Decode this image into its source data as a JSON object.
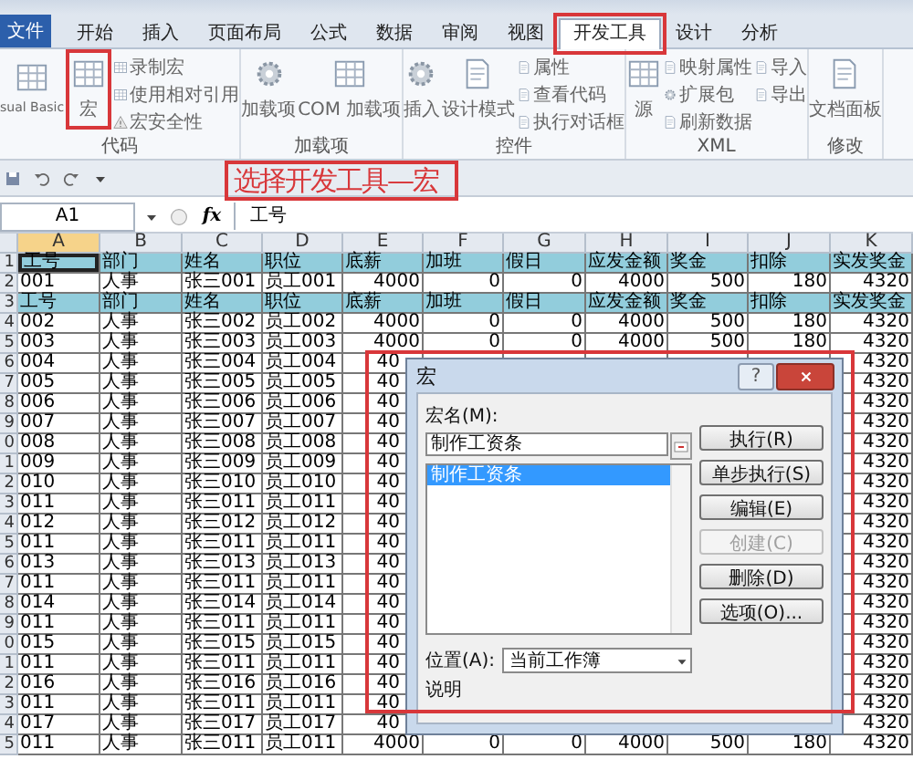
{
  "tabs": [
    {
      "label": "文件",
      "kind": "file",
      "selected": false
    },
    {
      "label": "开始",
      "kind": "tab",
      "selected": false
    },
    {
      "label": "插入",
      "kind": "tab",
      "selected": false
    },
    {
      "label": "页面布局",
      "kind": "tab",
      "selected": false
    },
    {
      "label": "公式",
      "kind": "tab",
      "selected": false
    },
    {
      "label": "数据",
      "kind": "tab",
      "selected": false
    },
    {
      "label": "审阅",
      "kind": "tab",
      "selected": false
    },
    {
      "label": "视图",
      "kind": "tab",
      "selected": false
    },
    {
      "label": "开发工具",
      "kind": "tab",
      "selected": true
    },
    {
      "label": "设计",
      "kind": "tab",
      "selected": false
    },
    {
      "label": "分析",
      "kind": "tab",
      "selected": false
    }
  ],
  "ribbon": {
    "groups": [
      {
        "label": "代码",
        "items": [
          {
            "label": "sual Basic",
            "kind": "large"
          },
          {
            "label": "宏",
            "kind": "large"
          },
          {
            "label": "录制宏",
            "kind": "small"
          },
          {
            "label": "使用相对引用",
            "kind": "small"
          },
          {
            "label": "宏安全性",
            "kind": "small"
          }
        ]
      },
      {
        "label": "加载项",
        "items": [
          {
            "label": "加载项",
            "kind": "large"
          },
          {
            "label": "COM 加载项",
            "kind": "large"
          }
        ]
      },
      {
        "label": "控件",
        "items": [
          {
            "label": "插入",
            "kind": "large"
          },
          {
            "label": "设计模式",
            "kind": "large"
          },
          {
            "label": "属性",
            "kind": "small"
          },
          {
            "label": "查看代码",
            "kind": "small"
          },
          {
            "label": "执行对话框",
            "kind": "small"
          }
        ]
      },
      {
        "label": "XML",
        "items": [
          {
            "label": "源",
            "kind": "large"
          },
          {
            "label": "映射属性",
            "kind": "small"
          },
          {
            "label": "扩展包",
            "kind": "small"
          },
          {
            "label": "刷新数据",
            "kind": "small"
          },
          {
            "label": "导入",
            "kind": "small"
          },
          {
            "label": "导出",
            "kind": "small"
          }
        ]
      },
      {
        "label": "修改",
        "items": [
          {
            "label": "文档面板",
            "kind": "large"
          }
        ]
      }
    ]
  },
  "annotation": {
    "text": "选择开发工具—宏"
  },
  "formula_bar": {
    "name_box": "A1",
    "function_label": "fx",
    "formula": "工号"
  },
  "sheet": {
    "columns": [
      {
        "label": "A",
        "selected": true
      },
      {
        "label": "B",
        "selected": false
      },
      {
        "label": "C",
        "selected": false
      },
      {
        "label": "D",
        "selected": false
      },
      {
        "label": "E",
        "selected": false
      },
      {
        "label": "F",
        "selected": false
      },
      {
        "label": "G",
        "selected": false
      },
      {
        "label": "H",
        "selected": false
      },
      {
        "label": "I",
        "selected": false
      },
      {
        "label": "J",
        "selected": false
      },
      {
        "label": "K",
        "selected": false
      }
    ],
    "rows": [
      {
        "number": "1",
        "kind": "header",
        "cells": [
          "工号",
          "部门",
          "姓名",
          "职位",
          "底薪",
          "加班",
          "假日",
          "应发金额",
          "奖金",
          "扣除",
          "实发奖金"
        ]
      },
      {
        "number": "2",
        "kind": "data",
        "cells": [
          "001",
          "人事",
          "张三001",
          "员工001",
          "4000",
          "0",
          "0",
          "4000",
          "500",
          "180",
          "4320"
        ]
      },
      {
        "number": "3",
        "kind": "header",
        "cells": [
          "工号",
          "部门",
          "姓名",
          "职位",
          "底薪",
          "加班",
          "假日",
          "应发金额",
          "奖金",
          "扣除",
          "实发奖金"
        ]
      },
      {
        "number": "4",
        "kind": "data",
        "cells": [
          "002",
          "人事",
          "张三002",
          "员工002",
          "4000",
          "0",
          "0",
          "4000",
          "500",
          "180",
          "4320"
        ]
      },
      {
        "number": "5",
        "kind": "data",
        "cells": [
          "003",
          "人事",
          "张三003",
          "员工003",
          "4000",
          "0",
          "0",
          "4000",
          "500",
          "180",
          "4320"
        ]
      },
      {
        "number": "6",
        "kind": "data",
        "cells": [
          "004",
          "人事",
          "张三004",
          "员工004",
          "40"
        ],
        "column_k": "4320"
      },
      {
        "number": "7",
        "kind": "data",
        "cells": [
          "005",
          "人事",
          "张三005",
          "员工005",
          "40"
        ],
        "column_k": "4320"
      },
      {
        "number": "8",
        "kind": "data",
        "cells": [
          "006",
          "人事",
          "张三006",
          "员工006",
          "40"
        ],
        "column_k": "4320"
      },
      {
        "number": "9",
        "kind": "data",
        "cells": [
          "007",
          "人事",
          "张三007",
          "员工007",
          "40"
        ],
        "column_k": "4320"
      },
      {
        "number": "0",
        "kind": "data",
        "cells": [
          "008",
          "人事",
          "张三008",
          "员工008",
          "40"
        ],
        "column_k": "4320"
      },
      {
        "number": "1",
        "kind": "data",
        "cells": [
          "009",
          "人事",
          "张三009",
          "员工009",
          "40"
        ],
        "column_k": "4320"
      },
      {
        "number": "2",
        "kind": "data",
        "cells": [
          "010",
          "人事",
          "张三010",
          "员工010",
          "40"
        ],
        "column_k": "4320"
      },
      {
        "number": "3",
        "kind": "data",
        "cells": [
          "011",
          "人事",
          "张三011",
          "员工011",
          "40"
        ],
        "column_k": "4320"
      },
      {
        "number": "4",
        "kind": "data",
        "cells": [
          "012",
          "人事",
          "张三012",
          "员工012",
          "40"
        ],
        "column_k": "4320"
      },
      {
        "number": "5",
        "kind": "data",
        "cells": [
          "011",
          "人事",
          "张三011",
          "员工011",
          "40"
        ],
        "column_k": "4320"
      },
      {
        "number": "6",
        "kind": "data",
        "cells": [
          "013",
          "人事",
          "张三013",
          "员工013",
          "40"
        ],
        "column_k": "4320"
      },
      {
        "number": "7",
        "kind": "data",
        "cells": [
          "011",
          "人事",
          "张三011",
          "员工011",
          "40"
        ],
        "column_k": "4320"
      },
      {
        "number": "8",
        "kind": "data",
        "cells": [
          "014",
          "人事",
          "张三014",
          "员工014",
          "40"
        ],
        "column_k": "4320"
      },
      {
        "number": "9",
        "kind": "data",
        "cells": [
          "011",
          "人事",
          "张三011",
          "员工011",
          "40"
        ],
        "column_k": "4320"
      },
      {
        "number": "0",
        "kind": "data",
        "cells": [
          "015",
          "人事",
          "张三015",
          "员工015",
          "40"
        ],
        "column_k": "4320"
      },
      {
        "number": "1",
        "kind": "data",
        "cells": [
          "011",
          "人事",
          "张三011",
          "员工011",
          "40"
        ],
        "column_k": "4320"
      },
      {
        "number": "2",
        "kind": "data",
        "cells": [
          "016",
          "人事",
          "张三016",
          "员工016",
          "40"
        ],
        "column_k": "4320"
      },
      {
        "number": "3",
        "kind": "data",
        "cells": [
          "011",
          "人事",
          "张三011",
          "员工011",
          "40"
        ],
        "column_k": "4320"
      },
      {
        "number": "4",
        "kind": "data",
        "cells": [
          "017",
          "人事",
          "张三017",
          "员工017",
          "40"
        ],
        "column_k": "4320"
      },
      {
        "number": "5",
        "kind": "data",
        "cells": [
          "011",
          "人事",
          "张三011",
          "员工011",
          "4000",
          "0",
          "0",
          "4000",
          "500",
          "180",
          "4320"
        ]
      }
    ]
  },
  "dialog": {
    "title": "宏",
    "help_button": "?",
    "name_label": "宏名(M):",
    "name_value": "制作工资条",
    "macros": [
      {
        "label": "制作工资条",
        "selected": true
      }
    ],
    "buttons": [
      {
        "label": "执行(R)",
        "disabled": false
      },
      {
        "label": "单步执行(S)",
        "disabled": false
      },
      {
        "label": "编辑(E)",
        "disabled": false
      },
      {
        "label": "创建(C)",
        "disabled": true
      },
      {
        "label": "删除(D)",
        "disabled": false
      },
      {
        "label": "选项(O)...",
        "disabled": false
      }
    ],
    "location_label": "位置(A):",
    "location_value": "当前工作簿",
    "description_label": "说明"
  }
}
